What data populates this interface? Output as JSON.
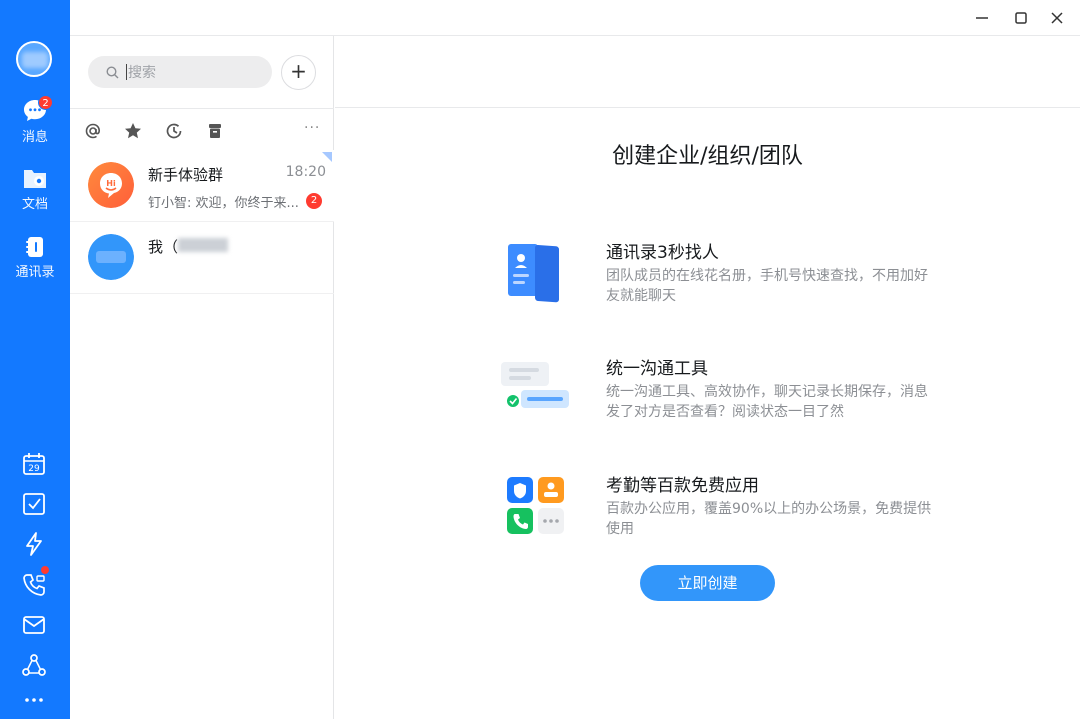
{
  "nav": {
    "items": [
      {
        "label": "消息",
        "badge": "2"
      },
      {
        "label": "文档"
      },
      {
        "label": "通讯录"
      }
    ],
    "tools": [
      "calendar-icon",
      "todo-icon",
      "lightning-icon",
      "phone-icon",
      "mail-icon",
      "apps-icon",
      "more-icon"
    ],
    "calendar_day": "29"
  },
  "search": {
    "placeholder": "搜索"
  },
  "add_button": "+",
  "filters": [
    "at-icon",
    "star-icon",
    "clock-icon",
    "archive-icon"
  ],
  "conversations": [
    {
      "name": "新手体验群",
      "time": "18:20",
      "preview": "钉小智: 欢迎，你终于来...",
      "unread": "2"
    },
    {
      "name": "我（",
      "time": "",
      "preview": ""
    }
  ],
  "main": {
    "title": "创建企业/组织/团队",
    "features": [
      {
        "heading": "通讯录3秒找人",
        "desc": "团队成员的在线花名册，手机号快速查找，不用加好友就能聊天"
      },
      {
        "heading": "统一沟通工具",
        "desc": "统一沟通工具、高效协作，聊天记录长期保存，消息发了对方是否查看？阅读状态一目了然"
      },
      {
        "heading": "考勤等百款免费应用",
        "desc": "百款办公应用，覆盖90%以上的办公场景，免费提供使用"
      }
    ],
    "create_button": "立即创建"
  },
  "colors": {
    "rail": "#1379ff",
    "accent": "#3296fa",
    "badge": "#ff3b30"
  }
}
